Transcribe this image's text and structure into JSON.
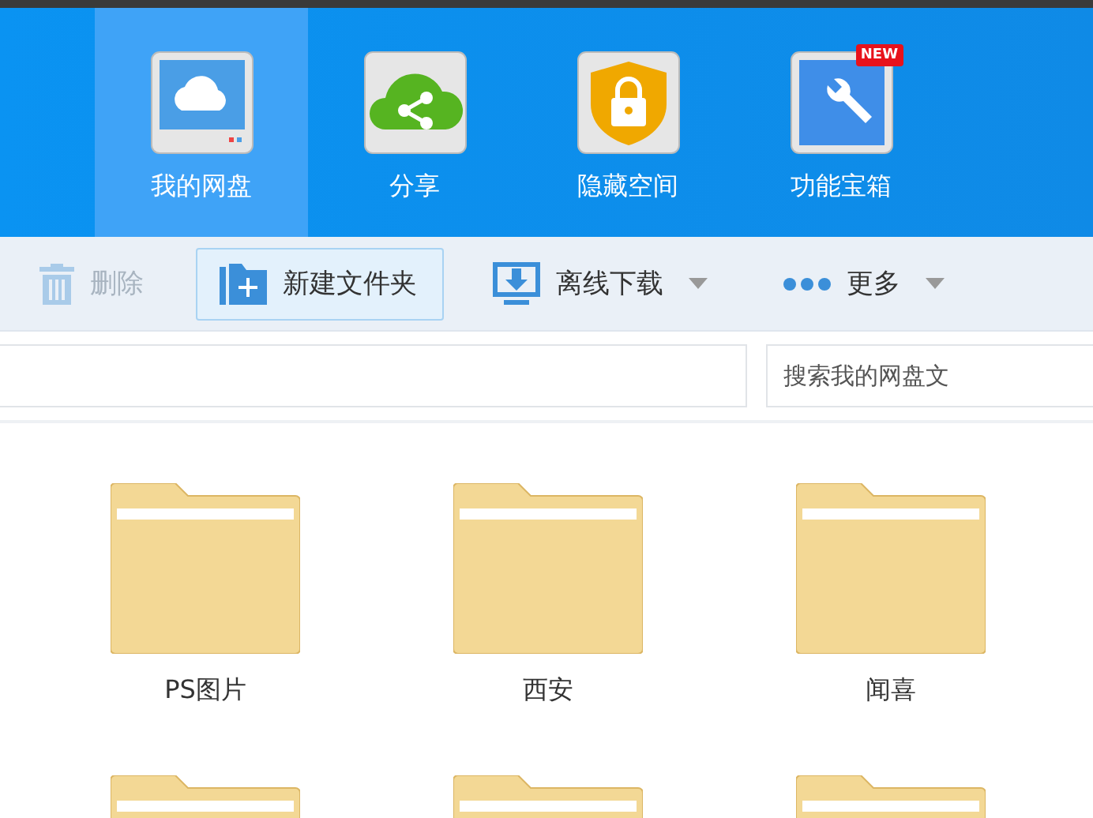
{
  "nav": [
    {
      "label": "我的网盘",
      "kind": "cloud",
      "selected": true
    },
    {
      "label": "分享",
      "kind": "share",
      "selected": false
    },
    {
      "label": "隐藏空间",
      "kind": "lock",
      "selected": false
    },
    {
      "label": "功能宝箱",
      "kind": "tools",
      "selected": false,
      "badge": "NEW"
    }
  ],
  "toolbar": [
    {
      "label": "删除",
      "kind": "trash",
      "disabled": true,
      "highlighted": false,
      "dropdown": false
    },
    {
      "label": "新建文件夹",
      "kind": "folder-plus",
      "disabled": false,
      "highlighted": true,
      "dropdown": false
    },
    {
      "label": "离线下载",
      "kind": "download",
      "disabled": false,
      "highlighted": false,
      "dropdown": true
    },
    {
      "label": "更多",
      "kind": "dots",
      "disabled": false,
      "highlighted": false,
      "dropdown": true
    }
  ],
  "search": {
    "placeholder": "搜索我的网盘文"
  },
  "folders": [
    {
      "kind": "folder",
      "name": "PS图片"
    },
    {
      "kind": "folder",
      "name": "西安"
    },
    {
      "kind": "folder",
      "name": "闻喜"
    },
    {
      "kind": "folder"
    },
    {
      "kind": "folder"
    },
    {
      "kind": "folder"
    }
  ]
}
